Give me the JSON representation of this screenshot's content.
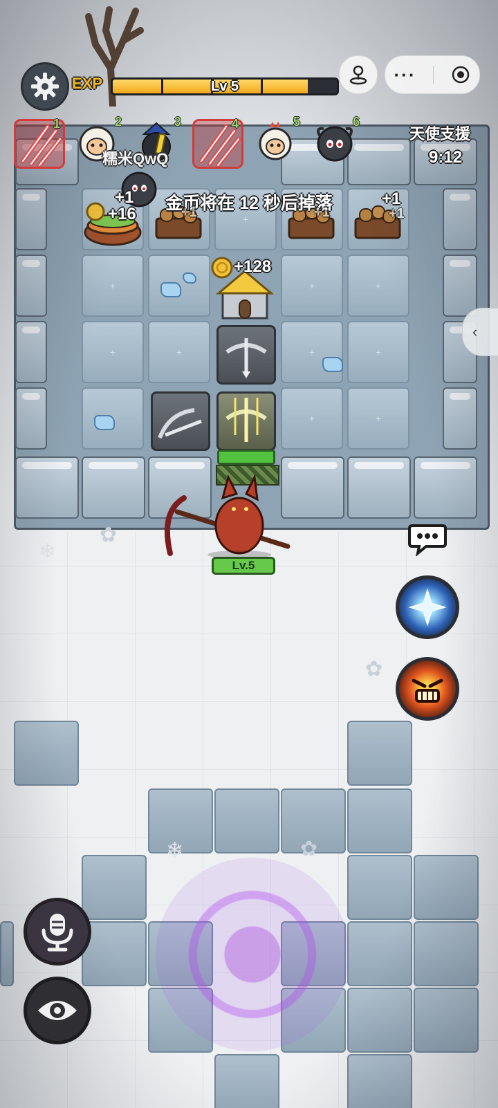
{
  "hud": {
    "exp_label": "EXP",
    "level_text": "Lv 5",
    "exp_progress": 0.87
  },
  "players": [
    {
      "slot": "1",
      "avatar": "claw-slash-icon",
      "highlighted": true
    },
    {
      "slot": "2",
      "avatar": "sheep-icon",
      "highlighted": false
    },
    {
      "slot": "3",
      "avatar": "penguin-mage-icon",
      "highlighted": false
    },
    {
      "slot": "4",
      "avatar": "claw-slash-icon",
      "highlighted": true
    },
    {
      "slot": "5",
      "avatar": "chicken-sheep-icon",
      "highlighted": false
    },
    {
      "slot": "6",
      "avatar": "black-sheep-icon",
      "highlighted": false
    }
  ],
  "nickname": "糯米QwQ",
  "angel_support": {
    "title": "天使支援",
    "timer": "9:12"
  },
  "notice": "金币将在 12 秒后掉落",
  "floating": {
    "plus_one_a": "+1",
    "plus_sixteen": "+16",
    "plus_one_b": "+1",
    "plus_one_c": "+1",
    "plus_one_d": "+1",
    "plus_one_e": "+1",
    "coin_gain": "+128"
  },
  "hero": {
    "level": "Lv.5"
  },
  "colors": {
    "accent_gold": "#f2b521",
    "hp_green": "#53c23f",
    "highlight_red": "#d23b3b",
    "rune_purple": "#a845e0"
  }
}
